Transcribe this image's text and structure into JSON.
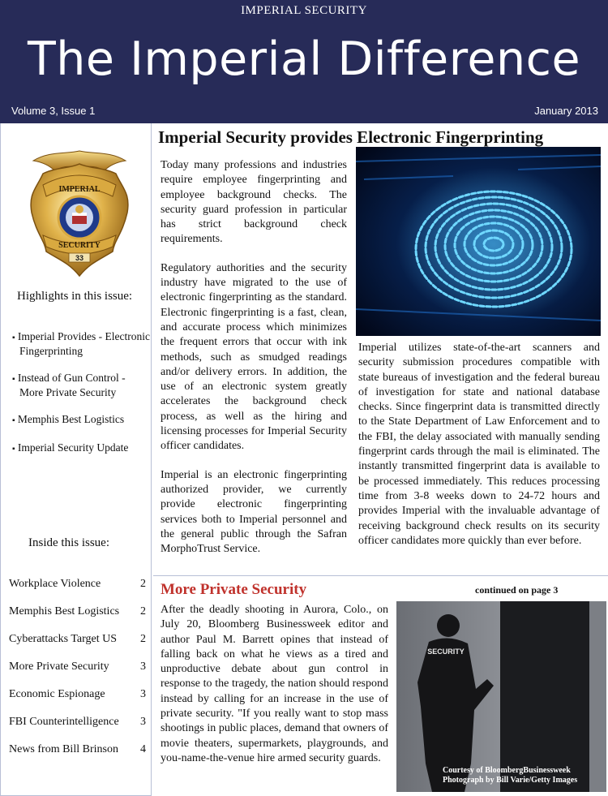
{
  "masthead": {
    "company": "IMPERIAL SECURITY",
    "title": "The Imperial Difference",
    "issue": "Volume 3, Issue 1",
    "date": "January  2013"
  },
  "sidebar": {
    "badge": {
      "top_word": "IMPERIAL",
      "bottom_word": "SECURITY",
      "number": "33"
    },
    "highlights_title": "Highlights in this issue:",
    "highlights": [
      "Imperial Provides - Electronic Fingerprinting",
      "Instead of Gun Control - More Private Security",
      "Memphis Best Logistics",
      "Imperial Security Update"
    ],
    "inside_title": "Inside this issue:",
    "inside": [
      {
        "title": "Workplace Violence",
        "page": "2"
      },
      {
        "title": "Memphis Best Logistics",
        "page": "2"
      },
      {
        "title": "Cyberattacks Target US",
        "page": "2"
      },
      {
        "title": "More Private Security",
        "page": "3"
      },
      {
        "title": "Economic Espionage",
        "page": "3"
      },
      {
        "title": "FBI Counterintelligence",
        "page": "3"
      },
      {
        "title": "News from Bill Brinson",
        "page": "4"
      }
    ]
  },
  "article1": {
    "headline": "Imperial Security provides Electronic Fingerprinting",
    "paragraphs": [
      "Today many professions and industries require employee fingerprinting and employee background checks. The security guard profession in particular has strict background check requirements.",
      "Regulatory authorities and the security industry have migrated to the use of electronic fingerprinting as the standard. Electronic fingerprinting is a fast, clean, and accurate process which minimizes the frequent errors that occur with ink methods, such as smudged readings and/or delivery errors. In addition, the use of an electronic system greatly accelerates the background check process, as well as the hiring and licensing processes for Imperial Security officer candidates.",
      "Imperial is an electronic fingerprinting authorized provider, we currently provide electronic fingerprinting services both to Imperial personnel and the general public through the Safran MorphoTrust Service."
    ],
    "right_paragraph": "Imperial utilizes state-of-the-art scanners and security submission procedures compatible with state bureaus of investigation and the federal bureau of investigation for state and national database checks. Since fingerprint data is transmitted directly to the State Department of Law Enforcement and to the FBI, the delay associated with manually sending fingerprint cards through the mail is eliminated. The instantly transmitted fingerprint data is available to be processed immediately. This reduces processing time from 3-8 weeks down to 24-72 hours and provides Imperial with the invaluable advantage of receiving background check results on its security officer candidates more quickly than ever before."
  },
  "article2": {
    "headline": "More Private Security",
    "continued": "continued on page 3",
    "paragraph": "After the deadly shooting in Aurora, Colo., on July 20, Bloomberg Businessweek editor and author Paul M. Barrett opines that instead of falling back on what he views as a tired and unproductive debate about gun control in response to the tragedy, the nation should respond instead by calling for an increase in the use of  private security. \"If you really want to stop mass shootings in public places, demand that owners of movie theaters, supermarkets, playgrounds, and you-name-the-venue hire armed security guards.",
    "photo_label": "SECURITY",
    "credit_line1": "Courtesy of BloombergBusinessweek",
    "credit_line2": "Photograph by Bill Varie/Getty Images"
  },
  "colors": {
    "masthead_bg": "#272b58",
    "headline2": "#c0322c",
    "rule": "#b8bfd6"
  }
}
